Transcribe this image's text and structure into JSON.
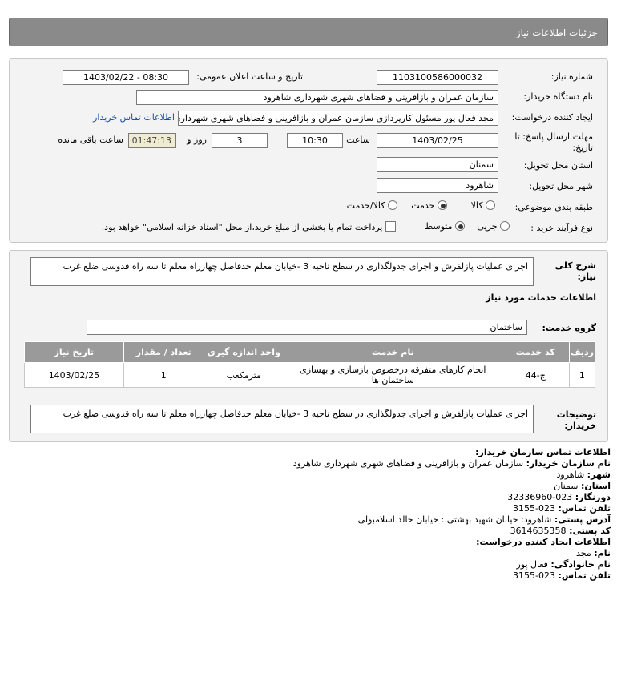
{
  "page_title": "جزئیات اطلاعات نیاز",
  "form": {
    "need_number_label": "شماره نیاز:",
    "need_number": "1103100586000032",
    "announce_label": "تاریخ و ساعت اعلان عمومی:",
    "announce_value": "1403/02/22 - 08:30",
    "buyer_org_label": "نام دستگاه خریدار:",
    "buyer_org": "سازمان عمران و بازافرینی و فضاهای شهری شهرداری شاهرود",
    "creator_label": "ایجاد کننده درخواست:",
    "creator": "مجد فعال پور مسئول کارپردازی سازمان عمران و بازافرینی و فضاهای شهری شهرداری شاهرود",
    "contact_link": "اطلاعات تماس خریدار",
    "deadline_label_1": "مهلت ارسال پاسخ: تا",
    "deadline_label_2": "تاریخ:",
    "deadline_date": "1403/02/25",
    "time_label": "ساعت",
    "deadline_time": "10:30",
    "days_value": "3",
    "days_label": "روز و",
    "remaining_time": "01:47:13",
    "remaining_label": "ساعت باقی مانده",
    "province_label": "استان محل تحویل:",
    "province": "سمنان",
    "city_label": "شهر محل تحویل:",
    "city": "شاهرود",
    "category_label": "طبقه بندی موضوعی:",
    "category_options": [
      "کالا",
      "خدمت",
      "کالا/خدمت"
    ],
    "category_selected": "خدمت",
    "process_label": "نوع فرآیند خرید :",
    "process_options": [
      "جزیی",
      "متوسط"
    ],
    "process_selected": "متوسط",
    "payment_note": "پرداخت تمام یا بخشی از مبلغ خرید،از محل \"اسناد خزانه اسلامی\" خواهد بود."
  },
  "details": {
    "summary_label_1": "شرح کلی",
    "summary_label_2": "نیاز:",
    "summary": "اجرای عملیات پازلفرش و اجرای جدولگذاری در سطح ناحیه 3 -خیابان معلم حدفاصل چهارراه معلم تا سه راه قدوسی ضلع غرب",
    "services_heading": "اطلاعات خدمات مورد نیاز",
    "service_group_label": "گروه خدمت:",
    "service_group": "ساختمان",
    "table_headers": [
      "ردیف",
      "کد خدمت",
      "نام خدمت",
      "واحد اندازه گیری",
      "تعداد / مقدار",
      "تاریخ نیاز"
    ],
    "table_rows": [
      {
        "row": "1",
        "code": "ج-44",
        "name": "انجام کارهای متفرقه درخصوص بازسازی و بهسازی ساختمان ها",
        "unit": "مترمکعب",
        "qty": "1",
        "date": "1403/02/25"
      }
    ],
    "buyer_notes_label_1": "توضیحات",
    "buyer_notes_label_2": "خریدار:",
    "buyer_notes": "اجرای عملیات پازلفرش و اجرای جدولگذاری در سطح ناحیه 3 -خیابان معلم حدفاصل چهارراه معلم تا سه راه قدوسی ضلع غرب"
  },
  "contact": {
    "heading": "اطلاعات تماس سازمان خریدار:",
    "org_key": "نام سازمان خریدار:",
    "org_val": "سازمان عمران و بازافرینی و فضاهای شهری شهرداری شاهرود",
    "city_key": "شهر:",
    "city_val": "شاهرود",
    "province_key": "استان:",
    "province_val": "سمنان",
    "fax_key": "دورنگار:",
    "fax_val": "023-32336960",
    "phone_key": "تلفن تماس:",
    "phone_val": "023-3155",
    "address_key": "آدرس پستی:",
    "address_val": "شاهرود: خیابان شهید بهشتی : خیابان خالد اسلامبولی",
    "postal_key": "کد پستی:",
    "postal_val": "3614635358",
    "creator_heading": "اطلاعات ایجاد کننده درخواست:",
    "name_key": "نام:",
    "name_val": "مجد",
    "family_key": "نام خانوادگی:",
    "family_val": "فعال پور",
    "creator_phone_key": "تلفن تماس:",
    "creator_phone_val": "023-3155"
  }
}
